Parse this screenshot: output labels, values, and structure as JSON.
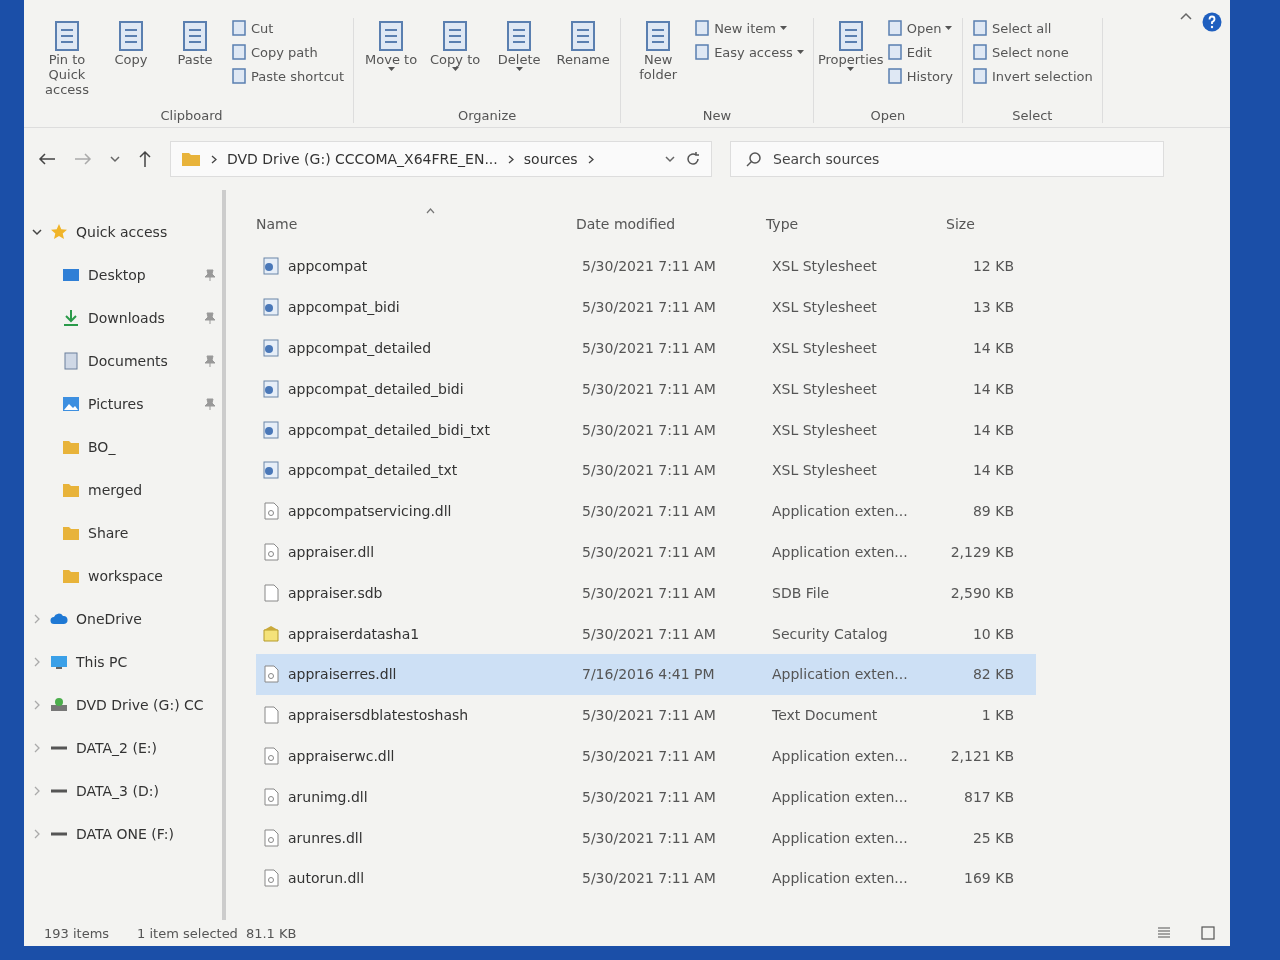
{
  "ribbon": {
    "groups": [
      {
        "label": "Clipboard",
        "items": [
          {
            "label": "Pin to Quick access",
            "kind": "large",
            "dropdown": false
          },
          {
            "label": "Copy",
            "kind": "large",
            "dropdown": false
          },
          {
            "label": "Paste",
            "kind": "large",
            "dropdown": false
          },
          {
            "label": "Cut",
            "kind": "small",
            "dropdown": false
          },
          {
            "label": "Copy path",
            "kind": "small",
            "dropdown": false
          },
          {
            "label": "Paste shortcut",
            "kind": "small",
            "dropdown": false
          }
        ]
      },
      {
        "label": "Organize",
        "items": [
          {
            "label": "Move to",
            "kind": "large",
            "dropdown": true
          },
          {
            "label": "Copy to",
            "kind": "large",
            "dropdown": true
          },
          {
            "label": "Delete",
            "kind": "large",
            "dropdown": true
          },
          {
            "label": "Rename",
            "kind": "large",
            "dropdown": false
          }
        ]
      },
      {
        "label": "New",
        "items": [
          {
            "label": "New folder",
            "kind": "large",
            "dropdown": false
          },
          {
            "label": "New item",
            "kind": "small",
            "dropdown": true
          },
          {
            "label": "Easy access",
            "kind": "small",
            "dropdown": true
          }
        ]
      },
      {
        "label": "Open",
        "items": [
          {
            "label": "Properties",
            "kind": "large",
            "dropdown": true
          },
          {
            "label": "Open",
            "kind": "small",
            "dropdown": true
          },
          {
            "label": "Edit",
            "kind": "small",
            "dropdown": false
          },
          {
            "label": "History",
            "kind": "small",
            "dropdown": false
          }
        ]
      },
      {
        "label": "Select",
        "items": [
          {
            "label": "Select all",
            "kind": "small",
            "dropdown": false
          },
          {
            "label": "Select none",
            "kind": "small",
            "dropdown": false
          },
          {
            "label": "Invert selection",
            "kind": "small",
            "dropdown": false
          }
        ]
      }
    ]
  },
  "address": {
    "segments": [
      "DVD Drive (G:) CCCOMA_X64FRE_EN...",
      "sources"
    ]
  },
  "search": {
    "placeholder": "Search sources"
  },
  "nav": [
    {
      "label": "Quick access",
      "kind": "star",
      "expanded": true,
      "children": [
        {
          "label": "Desktop",
          "kind": "desktop",
          "pinned": true
        },
        {
          "label": "Downloads",
          "kind": "download",
          "pinned": true
        },
        {
          "label": "Documents",
          "kind": "docs",
          "pinned": true
        },
        {
          "label": "Pictures",
          "kind": "pictures",
          "pinned": true
        },
        {
          "label": "BO_",
          "kind": "folder",
          "pinned": false
        },
        {
          "label": "merged",
          "kind": "folder",
          "pinned": false
        },
        {
          "label": "Share",
          "kind": "folder",
          "pinned": false
        },
        {
          "label": "workspace",
          "kind": "folder",
          "pinned": false
        }
      ]
    },
    {
      "label": "OneDrive",
      "kind": "cloud",
      "expanded": false
    },
    {
      "label": "This PC",
      "kind": "pc",
      "expanded": false
    },
    {
      "label": "DVD Drive (G:) CC",
      "kind": "dvd",
      "expanded": false
    },
    {
      "label": "DATA_2 (E:)",
      "kind": "drive",
      "expanded": false
    },
    {
      "label": "DATA_3 (D:)",
      "kind": "drive",
      "expanded": false
    },
    {
      "label": "DATA ONE (F:)",
      "kind": "drive",
      "expanded": false
    }
  ],
  "table": {
    "columns": [
      "Name",
      "Date modified",
      "Type",
      "Size"
    ],
    "rows": [
      {
        "name": "appcompat",
        "date": "5/30/2021 7:11 AM",
        "type": "XSL Stylesheet",
        "size": "12 KB",
        "kind": "xsl",
        "selected": false
      },
      {
        "name": "appcompat_bidi",
        "date": "5/30/2021 7:11 AM",
        "type": "XSL Stylesheet",
        "size": "13 KB",
        "kind": "xsl",
        "selected": false
      },
      {
        "name": "appcompat_detailed",
        "date": "5/30/2021 7:11 AM",
        "type": "XSL Stylesheet",
        "size": "14 KB",
        "kind": "xsl",
        "selected": false
      },
      {
        "name": "appcompat_detailed_bidi",
        "date": "5/30/2021 7:11 AM",
        "type": "XSL Stylesheet",
        "size": "14 KB",
        "kind": "xsl",
        "selected": false
      },
      {
        "name": "appcompat_detailed_bidi_txt",
        "date": "5/30/2021 7:11 AM",
        "type": "XSL Stylesheet",
        "size": "14 KB",
        "kind": "xsl",
        "selected": false
      },
      {
        "name": "appcompat_detailed_txt",
        "date": "5/30/2021 7:11 AM",
        "type": "XSL Stylesheet",
        "size": "14 KB",
        "kind": "xsl",
        "selected": false
      },
      {
        "name": "appcompatservicing.dll",
        "date": "5/30/2021 7:11 AM",
        "type": "Application exten...",
        "size": "89 KB",
        "kind": "dll",
        "selected": false
      },
      {
        "name": "appraiser.dll",
        "date": "5/30/2021 7:11 AM",
        "type": "Application exten...",
        "size": "2,129 KB",
        "kind": "dll",
        "selected": false
      },
      {
        "name": "appraiser.sdb",
        "date": "5/30/2021 7:11 AM",
        "type": "SDB File",
        "size": "2,590 KB",
        "kind": "file",
        "selected": false
      },
      {
        "name": "appraiserdatasha1",
        "date": "5/30/2021 7:11 AM",
        "type": "Security Catalog",
        "size": "10 KB",
        "kind": "cat",
        "selected": false
      },
      {
        "name": "appraiserres.dll",
        "date": "7/16/2016 4:41 PM",
        "type": "Application exten...",
        "size": "82 KB",
        "kind": "dll",
        "selected": true
      },
      {
        "name": "appraisersdblatestoshash",
        "date": "5/30/2021 7:11 AM",
        "type": "Text Document",
        "size": "1 KB",
        "kind": "file",
        "selected": false
      },
      {
        "name": "appraiserwc.dll",
        "date": "5/30/2021 7:11 AM",
        "type": "Application exten...",
        "size": "2,121 KB",
        "kind": "dll",
        "selected": false
      },
      {
        "name": "arunimg.dll",
        "date": "5/30/2021 7:11 AM",
        "type": "Application exten...",
        "size": "817 KB",
        "kind": "dll",
        "selected": false
      },
      {
        "name": "arunres.dll",
        "date": "5/30/2021 7:11 AM",
        "type": "Application exten...",
        "size": "25 KB",
        "kind": "dll",
        "selected": false
      },
      {
        "name": "autorun.dll",
        "date": "5/30/2021 7:11 AM",
        "type": "Application exten...",
        "size": "169 KB",
        "kind": "dll",
        "selected": false
      }
    ]
  },
  "status_bar": {
    "count": "193 items",
    "selection": "1 item selected",
    "selection_size": "81.1 KB"
  }
}
